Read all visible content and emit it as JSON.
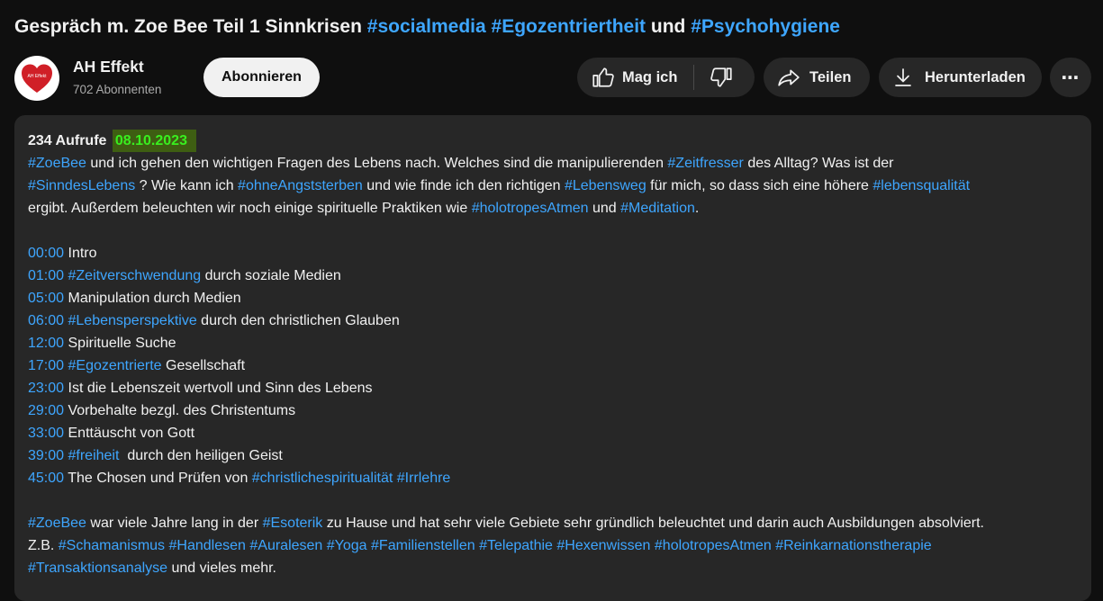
{
  "video": {
    "title_prefix": "Gespräch m. Zoe Bee Teil 1 Sinnkrisen",
    "title_tag1": "#socialmedia",
    "title_tag2": "#Egozentriertheit",
    "title_and": "und",
    "title_tag3": "#Psychohygiene"
  },
  "channel": {
    "name": "AH Effekt",
    "subscribers": "702 Abonnenten",
    "avatar_text": "AH Effekt",
    "subscribe_label": "Abonnieren"
  },
  "actions": {
    "like_label": "Mag ich",
    "share_label": "Teilen",
    "download_label": "Herunterladen",
    "more_label": "⋯"
  },
  "description": {
    "views": "234 Aufrufe",
    "date": "08.10.2023",
    "intro": {
      "t1": "#ZoeBee",
      "t2": " und ich gehen den wichtigen Fragen des Lebens nach. Welches sind die manipulierenden ",
      "t3": "#Zeitfresser",
      "t4": " des Alltag? Was ist der",
      "t5": "#SinndesLebens",
      "t6": " ? Wie kann ich ",
      "t7": "#ohneAngststerben",
      "t8": " und wie finde ich den richtigen ",
      "t9": "#Lebensweg",
      "t10": " für mich, so dass sich eine höhere ",
      "t11": "#lebensqualität",
      "t12": "ergibt. Außerdem beleuchten wir noch einige spirituelle Praktiken wie ",
      "t13": "#holotropesAtmen",
      "t14": " und ",
      "t15": "#Meditation",
      "t16": "."
    },
    "chapters": [
      {
        "time": "00:00",
        "tag": "",
        "text": " Intro"
      },
      {
        "time": "01:00",
        "tag": "#Zeitverschwendung",
        "text": " durch soziale Medien"
      },
      {
        "time": "05:00",
        "tag": "",
        "text": " Manipulation durch Medien"
      },
      {
        "time": "06:00",
        "tag": "#Lebensperspektive",
        "text": " durch den christlichen Glauben"
      },
      {
        "time": "12:00",
        "tag": "",
        "text": " Spirituelle Suche"
      },
      {
        "time": "17:00",
        "tag": "#Egozentrierte",
        "text": " Gesellschaft"
      },
      {
        "time": "23:00",
        "tag": "",
        "text": " Ist die Lebenszeit wertvoll und Sinn des Lebens"
      },
      {
        "time": "29:00",
        "tag": "",
        "text": " Vorbehalte bezgl. des Christentums"
      },
      {
        "time": "33:00",
        "tag": "",
        "text": " Enttäuscht von Gott"
      },
      {
        "time": "39:00",
        "tag": "#freiheit",
        "text": "  durch den heiligen Geist"
      },
      {
        "time": "45:00",
        "tag": "",
        "text": " The Chosen und Prüfen von ",
        "tag2": "#christlichespiritualität",
        "tag3": "#Irrlehre"
      }
    ],
    "outro": {
      "t1": "#ZoeBee",
      "t2": " war viele Jahre lang in der ",
      "t3": "#Esoterik",
      "t4": " zu Hause und hat sehr viele Gebiete sehr gründlich beleuchtet und darin auch Ausbildungen absolviert.",
      "t5": "Z.B. ",
      "tags": [
        "#Schamanismus",
        "#Handlesen",
        "#Auralesen",
        "#Yoga",
        "#Familienstellen",
        "#Telepathie",
        "#Hexenwissen",
        "#holotropesAtmen",
        "#Reinkarnationstherapie"
      ],
      "t6": "#Transaktionsanalyse",
      "t7": " und vieles mehr."
    }
  }
}
